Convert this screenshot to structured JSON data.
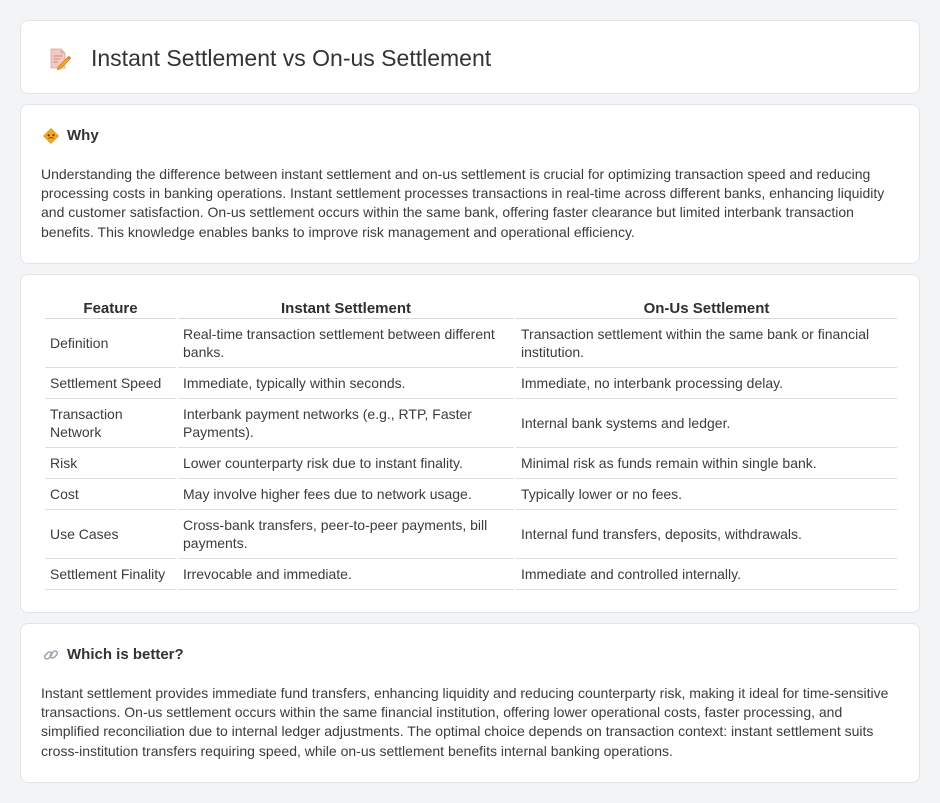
{
  "header": {
    "icon": "document-edit-icon",
    "title": "Instant Settlement vs On-us Settlement"
  },
  "why": {
    "icon": "diamond-warning-icon",
    "title": "Why",
    "body": "Understanding the difference between instant settlement and on-us settlement is crucial for optimizing transaction speed and reducing processing costs in banking operations. Instant settlement processes transactions in real-time across different banks, enhancing liquidity and customer satisfaction. On-us settlement occurs within the same bank, offering faster clearance but limited interbank transaction benefits. This knowledge enables banks to improve risk management and operational efficiency."
  },
  "table": {
    "headers": [
      "Feature",
      "Instant Settlement",
      "On-Us Settlement"
    ],
    "rows": [
      [
        "Definition",
        "Real-time transaction settlement between different banks.",
        "Transaction settlement within the same bank or financial institution."
      ],
      [
        "Settlement Speed",
        "Immediate, typically within seconds.",
        "Immediate, no interbank processing delay."
      ],
      [
        "Transaction Network",
        "Interbank payment networks (e.g., RTP, Faster Payments).",
        "Internal bank systems and ledger."
      ],
      [
        "Risk",
        "Lower counterparty risk due to instant finality.",
        "Minimal risk as funds remain within single bank."
      ],
      [
        "Cost",
        "May involve higher fees due to network usage.",
        "Typically lower or no fees."
      ],
      [
        "Use Cases",
        "Cross-bank transfers, peer-to-peer payments, bill payments.",
        "Internal fund transfers, deposits, withdrawals."
      ],
      [
        "Settlement Finality",
        "Irrevocable and immediate.",
        "Immediate and controlled internally."
      ]
    ]
  },
  "better": {
    "icon": "link-icon",
    "title": "Which is better?",
    "body": "Instant settlement provides immediate fund transfers, enhancing liquidity and reducing counterparty risk, making it ideal for time-sensitive transactions. On-us settlement occurs within the same financial institution, offering lower operational costs, faster processing, and simplified reconciliation due to internal ledger adjustments. The optimal choice depends on transaction context: instant settlement suits cross-institution transfers requiring speed, while on-us settlement benefits internal banking operations."
  }
}
